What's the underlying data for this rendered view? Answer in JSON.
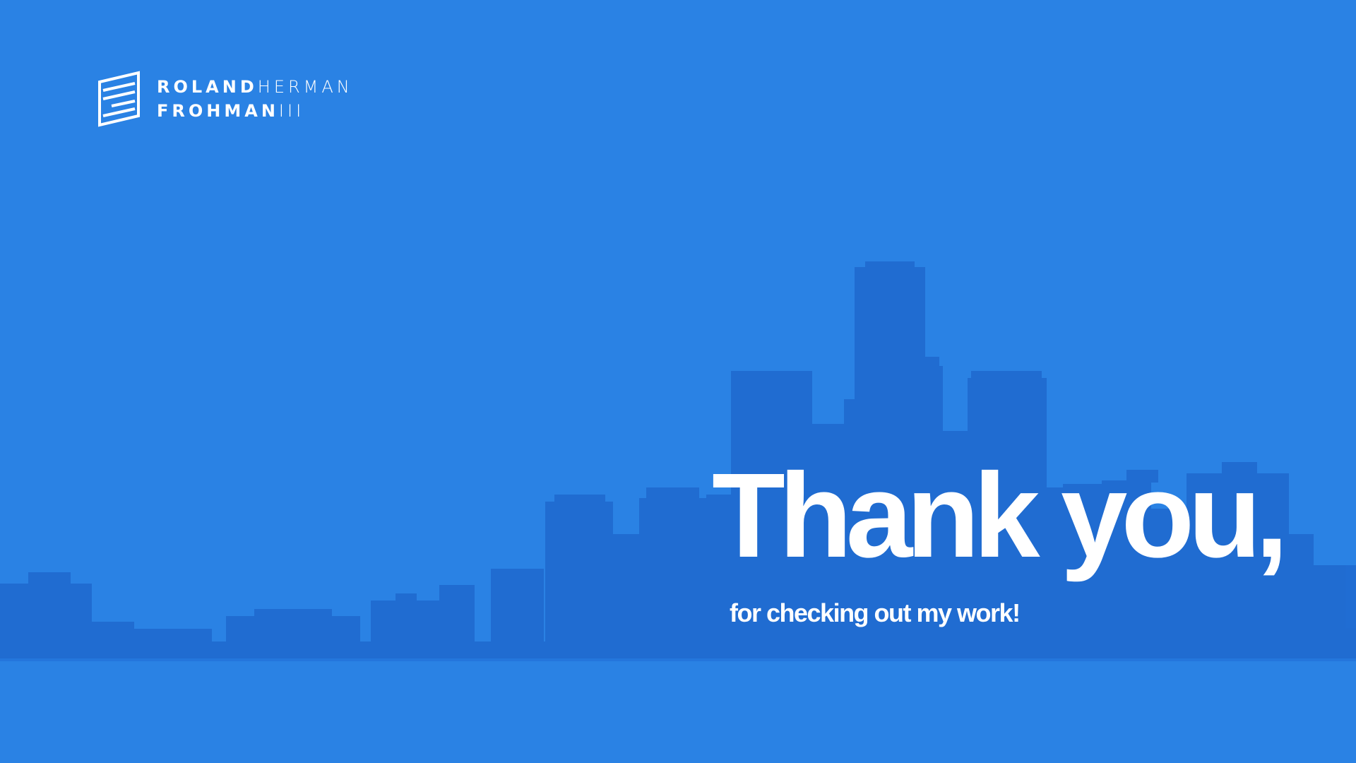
{
  "logo": {
    "line1_bold": "ROLAND",
    "line1_light": "HERMAN",
    "line2_bold": "FROHMAN",
    "line2_light": "III"
  },
  "headline": "Thank you,",
  "subline": "for checking out my work!",
  "colors": {
    "background": "#2a82e4",
    "skyline": "#1f6ad0",
    "text": "#ffffff"
  }
}
